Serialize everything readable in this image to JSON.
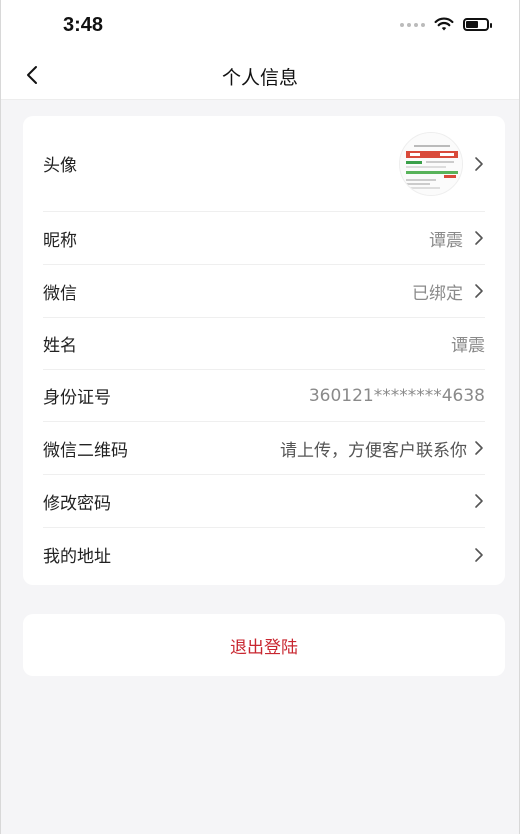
{
  "status_bar": {
    "time": "3:48"
  },
  "nav": {
    "title": "个人信息"
  },
  "profile": {
    "avatar": {
      "label": "头像"
    },
    "nickname": {
      "label": "昵称",
      "value": "谭震"
    },
    "wechat": {
      "label": "微信",
      "value": "已绑定"
    },
    "name": {
      "label": "姓名",
      "value": "谭震"
    },
    "id_number": {
      "label": "身份证号",
      "value": "360121********4638"
    },
    "wechat_qr": {
      "label": "微信二维码",
      "value": "请上传，方便客户联系你"
    },
    "change_password": {
      "label": "修改密码"
    },
    "address": {
      "label": "我的地址"
    }
  },
  "logout": {
    "label": "退出登陆"
  },
  "colors": {
    "accent": "#c8262f",
    "background": "#f5f5f7",
    "card": "#ffffff"
  }
}
